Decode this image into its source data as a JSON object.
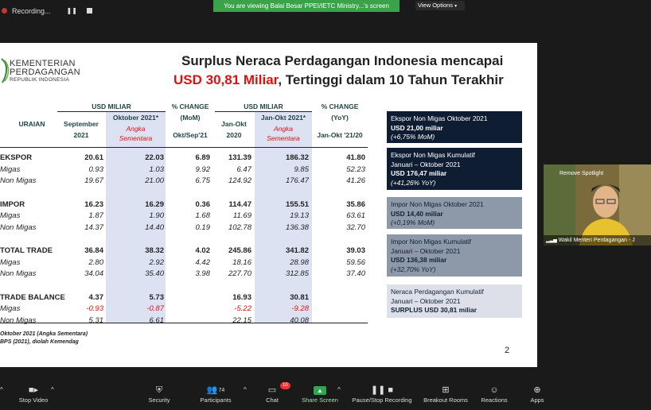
{
  "top": {
    "recording_label": "Recording...",
    "viewing_label": "You are viewing Balai Besar PPEI/IETC Ministry...'s screen",
    "view_options_label": "View Options"
  },
  "slide": {
    "logo_line1": "KEMENTERIAN",
    "logo_line2": "PERDAGANGAN",
    "logo_line3": "REPUBLIK INDONESIA",
    "title_line1": "Surplus Neraca Perdagangan Indonesia mencapai",
    "title_red": "USD 30,81 Miliar",
    "title_rest": ", Tertinggi dalam 10 Tahun Terakhir",
    "headers": {
      "uraian": "URAIAN",
      "usd_miliar_1": "USD MILIAR",
      "pct_change_mom": "% CHANGE",
      "mom": "(MoM)",
      "usd_miliar_2": "USD MILIAR",
      "pct_change_yoy": "% CHANGE",
      "yoy": "(YoY)",
      "sep2021_a": "September",
      "sep2021_b": "2021",
      "okt2021_a": "Oktober 2021*",
      "okt2021_b": "Angka",
      "okt2021_c": "Sementara",
      "okt_sep": "Okt/Sep'21",
      "janokt2020_a": "Jan-Okt",
      "janokt2020_b": "2020",
      "janokt2021_a": "Jan-Okt 2021*",
      "janokt2021_b": "Angka",
      "janokt2021_c": "Sementara",
      "janokt_2120": "Jan-Okt '21/20"
    },
    "rows": [
      {
        "label": "EKSPOR",
        "bold": true,
        "v": [
          "20.61",
          "22.03",
          "6.89",
          "131.39",
          "186.32",
          "41.80"
        ]
      },
      {
        "label": "Migas",
        "bold": false,
        "v": [
          "0.93",
          "1.03",
          "9.92",
          "6.47",
          "9.85",
          "52.23"
        ]
      },
      {
        "label": "Non Migas",
        "bold": false,
        "v": [
          "19.67",
          "21.00",
          "6.75",
          "124.92",
          "176.47",
          "41.26"
        ]
      },
      {
        "label": "IMPOR",
        "bold": true,
        "v": [
          "16.23",
          "16.29",
          "0.36",
          "114.47",
          "155.51",
          "35.86"
        ]
      },
      {
        "label": "Migas",
        "bold": false,
        "v": [
          "1.87",
          "1.90",
          "1.68",
          "11.69",
          "19.13",
          "63.61"
        ]
      },
      {
        "label": "Non Migas",
        "bold": false,
        "v": [
          "14.37",
          "14.40",
          "0.19",
          "102.78",
          "136.38",
          "32.70"
        ]
      },
      {
        "label": "TOTAL TRADE",
        "bold": true,
        "v": [
          "36.84",
          "38.32",
          "4.02",
          "245.86",
          "341.82",
          "39.03"
        ]
      },
      {
        "label": "Migas",
        "bold": false,
        "v": [
          "2.80",
          "2.92",
          "4.42",
          "18.16",
          "28.98",
          "59.56"
        ]
      },
      {
        "label": "Non Migas",
        "bold": false,
        "v": [
          "34.04",
          "35.40",
          "3.98",
          "227.70",
          "312.85",
          "37.40"
        ]
      },
      {
        "label": "TRADE BALANCE",
        "bold": true,
        "v": [
          "4.37",
          "5.73",
          "",
          "16.93",
          "30.81",
          ""
        ]
      },
      {
        "label": "Migas",
        "bold": false,
        "v": [
          "-0.93",
          "-0.87",
          "",
          "-5.22",
          "-9.28",
          ""
        ]
      },
      {
        "label": "Non Migas",
        "bold": false,
        "v": [
          "5.31",
          "6.61",
          "",
          "22.15",
          "40.08",
          ""
        ]
      }
    ],
    "footnote1": "Oktober 2021 (Angka Sementara)",
    "footnote2": "BPS  (2021), diolah Kemendag",
    "page_number": "2",
    "boxes": [
      {
        "line1": "Ekspor Non Migas Oktober 2021",
        "line2": "",
        "value": "USD 21,00 miliar",
        "change": "(+6,75% MoM)"
      },
      {
        "line1": "Ekspor Non Migas Kumulatif",
        "line2": "Januari – Oktober 2021",
        "value": "USD 176,47 miliar",
        "change": "(+41,26% YoY)"
      },
      {
        "line1": "Impor Non Migas Oktober 2021",
        "line2": "",
        "value": "USD 14,40 miliar",
        "change": "(+0,19% MoM)"
      },
      {
        "line1": "Impor Non Migas Kumulatif",
        "line2": "Januari – Oktober 2021",
        "value": "USD 136,38 miliar",
        "change": "(+32,70% YoY)"
      },
      {
        "line1": "Neraca Perdagangan Kumulatif",
        "line2": "Januari – Oktober 2021",
        "value": "SURPLUS USD 30,81 miliar",
        "change": ""
      }
    ]
  },
  "video": {
    "remove_spotlight_label": "Remove Spotlight",
    "participant_name": "Wakil Menteri Perdagangan - J"
  },
  "toolbar": {
    "stop_video": "Stop Video",
    "security": "Security",
    "participants": "Participants",
    "participants_count": "74",
    "chat": "Chat",
    "chat_badge": "10",
    "share_screen": "Share Screen",
    "pause_stop_recording": "Pause/Stop Recording",
    "breakout_rooms": "Breakout Rooms",
    "reactions": "Reactions",
    "apps": "Apps"
  },
  "colors": {
    "accent_green": "#3aa34a",
    "title_red": "#d11111",
    "box_dark": "#0f1d33",
    "box_gray": "#8d99a8",
    "box_light": "#dde0e8",
    "shade": "#dde2f3"
  }
}
